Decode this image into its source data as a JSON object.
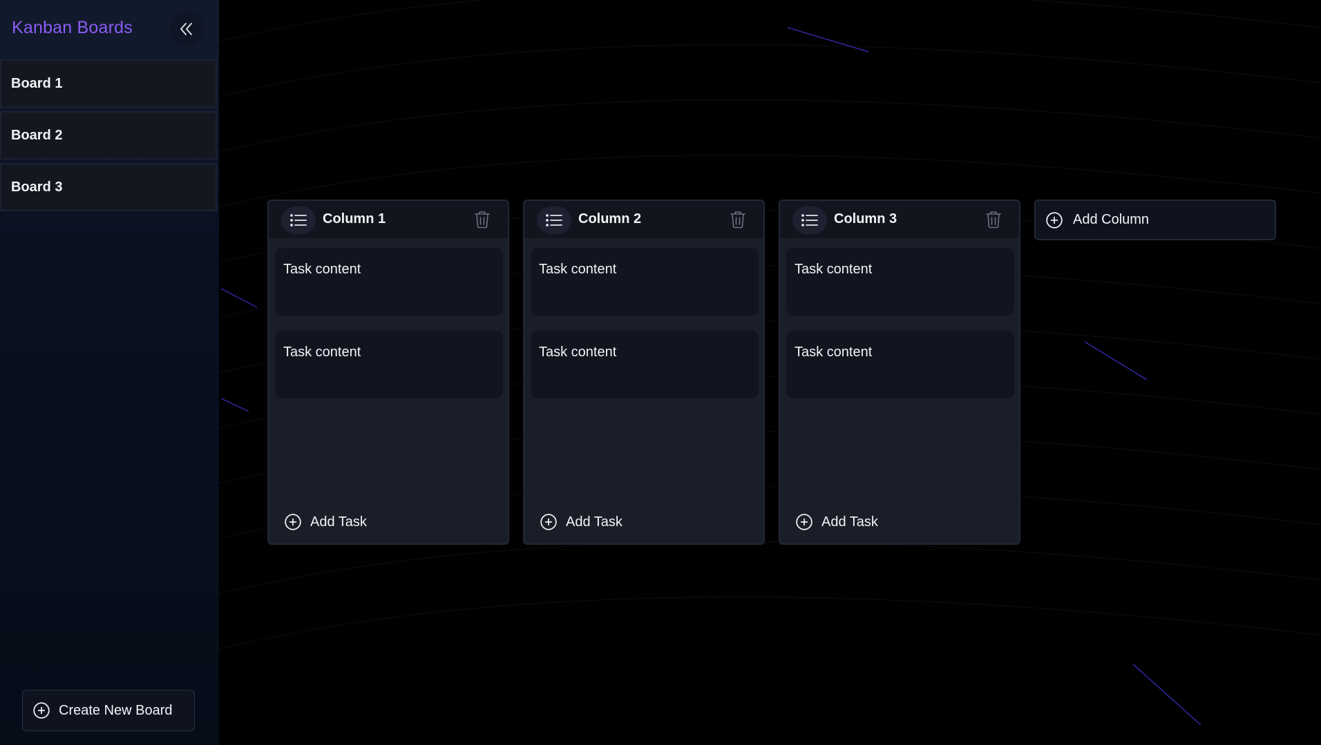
{
  "sidebar": {
    "title": "Kanban Boards",
    "collapse_icon": "chevrons-left-icon",
    "boards": [
      {
        "label": "Board 1"
      },
      {
        "label": "Board 2"
      },
      {
        "label": "Board 3"
      }
    ],
    "create_board_label": "Create New Board",
    "create_board_icon": "plus-circle-icon"
  },
  "colors": {
    "accent": "#8b5cf6",
    "background": "#000000",
    "sidebar": "#0a1020",
    "column": "#1a1e28",
    "card": "#111520"
  },
  "columns": [
    {
      "title": "Column 1",
      "tasks": [
        {
          "content": "Task content"
        },
        {
          "content": "Task content"
        }
      ],
      "add_task_label": "Add Task"
    },
    {
      "title": "Column 2",
      "tasks": [
        {
          "content": "Task content"
        },
        {
          "content": "Task content"
        }
      ],
      "add_task_label": "Add Task"
    },
    {
      "title": "Column 3",
      "tasks": [
        {
          "content": "Task content"
        },
        {
          "content": "Task content"
        }
      ],
      "add_task_label": "Add Task"
    }
  ],
  "add_column_label": "Add Column",
  "icons": {
    "drag_handle": "list-icon",
    "delete": "trash-icon",
    "add": "plus-circle-icon"
  }
}
